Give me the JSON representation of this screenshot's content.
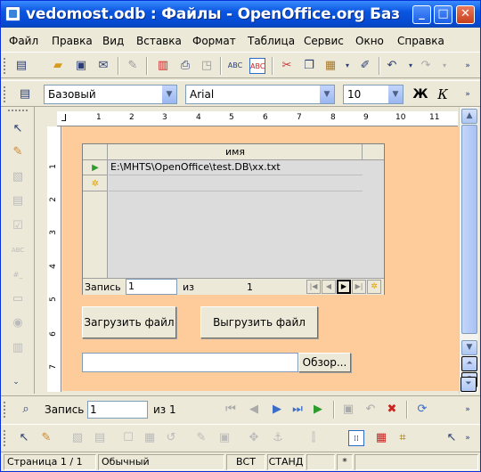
{
  "window": {
    "title": "vedomost.odb : Файлы - OpenOffice.org Баз…"
  },
  "menu": [
    "Файл",
    "Правка",
    "Вид",
    "Вставка",
    "Формат",
    "Таблица",
    "Сервис",
    "Окно",
    "Справка"
  ],
  "format_bar": {
    "style": "Базовый",
    "font": "Arial",
    "size": "10",
    "bold": "Ж",
    "italic": "К"
  },
  "ruler": {
    "ticks": [
      "1",
      "2",
      "3",
      "4",
      "5",
      "6",
      "7",
      "8",
      "9",
      "10",
      "11"
    ],
    "vticks": [
      "1",
      "2",
      "3",
      "4",
      "5",
      "6",
      "7"
    ]
  },
  "grid": {
    "column": "имя",
    "rows": [
      "E:\\MHTS\\OpenOffice\\test.DB\\xx.txt",
      ""
    ],
    "nav": {
      "record_label": "Запись",
      "record_value": "1",
      "of_label": "из",
      "total": "1"
    }
  },
  "buttons": {
    "load": "Загрузить файл",
    "upload": "Выгрузить файл",
    "browse": "Обзор..."
  },
  "file_input": {
    "value": ""
  },
  "navbar": {
    "record_label": "Запись",
    "record_value": "1",
    "of_text": "из  1"
  },
  "status": {
    "page": "Страница  1 / 1",
    "style": "Обычный",
    "mode1": "ВСТ",
    "mode2": "СТАНД",
    "modified": "*"
  },
  "colors": {
    "canvas": "#fecb9a",
    "title": "#0a56e0"
  }
}
